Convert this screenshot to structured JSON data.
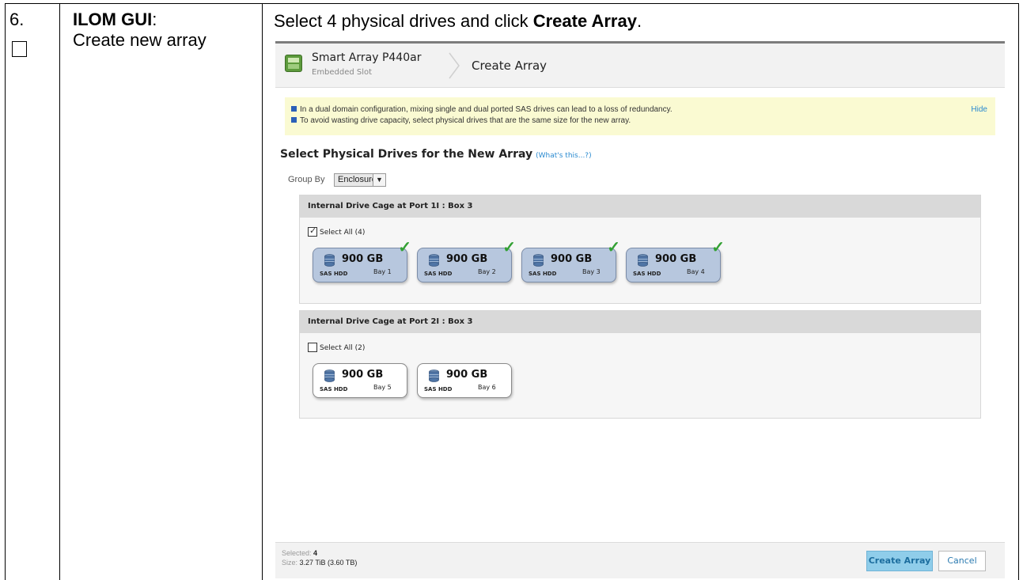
{
  "step": {
    "number": "6."
  },
  "procedure": {
    "title": "ILOM GUI",
    "title_suffix": ":",
    "subtitle": "Create new array"
  },
  "instruction": {
    "prefix": "Select 4 physical drives and click ",
    "button_ref": "Create Array",
    "suffix": "."
  },
  "screenshot": {
    "header": {
      "controller": "Smart Array P440ar",
      "slot": "Embedded Slot",
      "page": "Create Array",
      "icon": "controller-icon"
    },
    "notice": {
      "lines": [
        "In a dual domain configuration, mixing single and dual ported SAS drives can lead to a loss of redundancy.",
        "To avoid wasting drive capacity, select physical drives that are the same size for the new array."
      ],
      "hide": "Hide"
    },
    "section": {
      "title": "Select Physical Drives for the New Array",
      "help": "(What's this...?)"
    },
    "group_by": {
      "label": "Group By",
      "value": "Enclosure"
    },
    "cages": [
      {
        "title": "Internal Drive Cage at Port 1I : Box 3",
        "select_all": "Select All (4)",
        "all_checked": true,
        "drives": [
          {
            "capacity": "900 GB",
            "type": "SAS HDD",
            "bay": "Bay 1",
            "selected": true
          },
          {
            "capacity": "900 GB",
            "type": "SAS HDD",
            "bay": "Bay 2",
            "selected": true
          },
          {
            "capacity": "900 GB",
            "type": "SAS HDD",
            "bay": "Bay 3",
            "selected": true
          },
          {
            "capacity": "900 GB",
            "type": "SAS HDD",
            "bay": "Bay 4",
            "selected": true
          }
        ]
      },
      {
        "title": "Internal Drive Cage at Port 2I : Box 3",
        "select_all": "Select All (2)",
        "all_checked": false,
        "drives": [
          {
            "capacity": "900 GB",
            "type": "SAS HDD",
            "bay": "Bay 5",
            "selected": false
          },
          {
            "capacity": "900 GB",
            "type": "SAS HDD",
            "bay": "Bay 6",
            "selected": false
          }
        ]
      }
    ],
    "footer": {
      "selected_label": "Selected:",
      "selected_value": "4",
      "size_label": "Size:",
      "size_value": "3.27 TiB (3.60 TB)",
      "create_button": "Create Array",
      "cancel_button": "Cancel"
    }
  }
}
